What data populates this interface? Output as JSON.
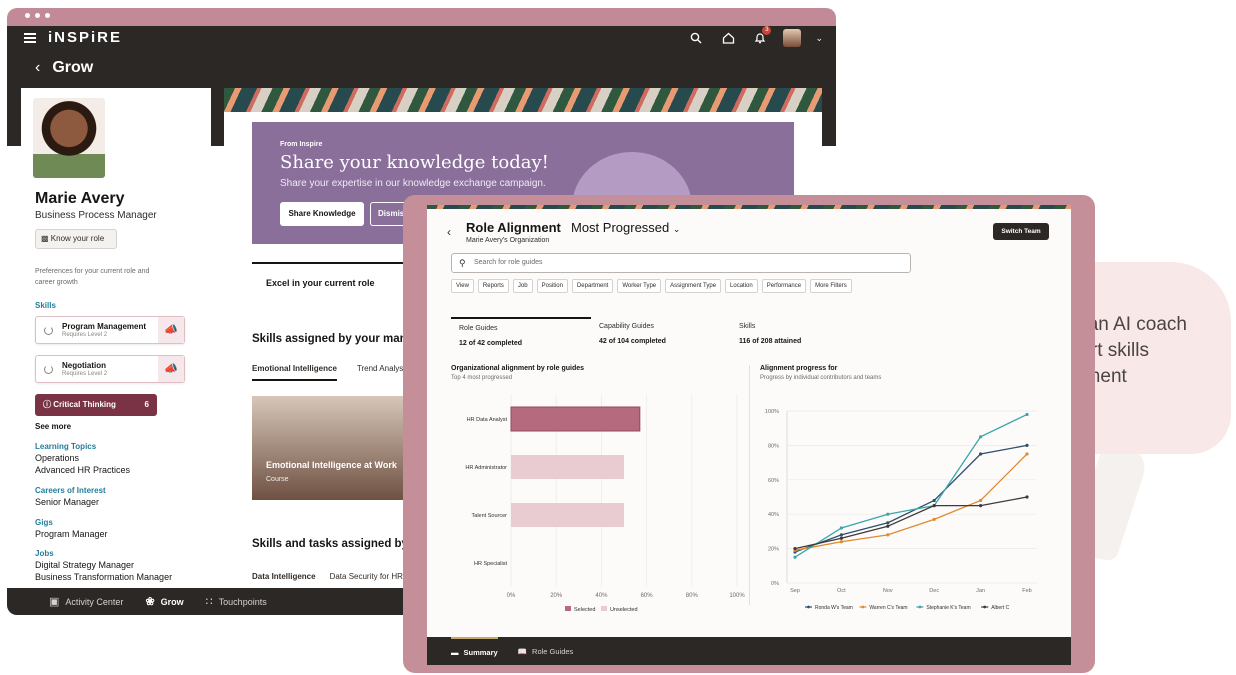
{
  "back_app": {
    "brand": "iNSPiRE",
    "notification_count": "3",
    "page_title": "Grow",
    "profile": {
      "name": "Marie Avery",
      "role": "Business Process Manager",
      "know_role_button": "Know your role",
      "preferences_text": "Preferences for your current role and career growth"
    },
    "skills": {
      "heading": "Skills",
      "items": [
        {
          "name": "Program Management",
          "level": "Requires Level 2"
        },
        {
          "name": "Negotiation",
          "level": "Requires Level 2"
        }
      ],
      "critical": {
        "label": "Critical Thinking",
        "count": "6"
      },
      "see_more": "See more"
    },
    "sections": [
      {
        "heading": "Learning Topics",
        "items": [
          "Operations",
          "Advanced HR Practices"
        ]
      },
      {
        "heading": "Careers of Interest",
        "items": [
          "Senior Manager"
        ]
      },
      {
        "heading": "Gigs",
        "items": [
          "Program Manager"
        ]
      },
      {
        "heading": "Jobs",
        "items": [
          "Digital Strategy Manager",
          "Business Transformation Manager"
        ]
      }
    ],
    "banner": {
      "from": "From Inspire",
      "heading": "Share your knowledge today!",
      "subtext": "Share your expertise in our knowledge exchange campaign.",
      "primary_button": "Share Knowledge",
      "secondary_button": "Dismiss"
    },
    "excel_tab": "Excel in your current role",
    "skills_assigned_heading": "Skills assigned by your manager",
    "skill_tabs": [
      "Emotional Intelligence",
      "Trend Analysis"
    ],
    "course_card": {
      "title": "Emotional Intelligence at Work",
      "type": "Course"
    },
    "tasks_heading": "Skills and tasks assigned by your manager",
    "task_tabs": [
      "Data Intelligence",
      "Data Security for HR"
    ],
    "bottom_nav": [
      "Activity Center",
      "Grow",
      "Touchpoints"
    ]
  },
  "front_app": {
    "title": "Role Alignment",
    "mode": "Most Progressed",
    "org": "Marie Avery's Organization",
    "switch_team": "Switch Team",
    "search_placeholder": "Search for role guides",
    "filters": [
      "View",
      "Reports",
      "Job",
      "Position",
      "Department",
      "Worker Type",
      "Assignment Type",
      "Location",
      "Performance",
      "More Filters"
    ],
    "metrics": [
      {
        "label": "Role Guides",
        "value": "12 of 42 completed"
      },
      {
        "label": "Capability Guides",
        "value": "42 of 104 completed"
      },
      {
        "label": "Skills",
        "value": "116 of 208 attained"
      }
    ],
    "bar_chart_title": "Organizational alignment by role guides",
    "bar_chart_subtitle": "Top 4 most progressed",
    "line_chart_title": "Alignment progress for",
    "line_chart_subtitle": "Progress by individual contributors and teams",
    "bottom_nav": [
      "Summary",
      "Role Guides"
    ]
  },
  "colors": {
    "dark_bar": "#2b2826",
    "frame": "#c58f99",
    "bar_selected": "#b56a7e",
    "bar_unselected": "#e8ccd2",
    "series": [
      "#2f4f6f",
      "#e08a2e",
      "#3aa6a8",
      "#3f3a36"
    ]
  },
  "chart_data": [
    {
      "type": "bar",
      "orientation": "horizontal",
      "categories": [
        "HR Data Analyst",
        "HR Administrator",
        "Talent Sourcer",
        "HR Specialist"
      ],
      "values": [
        57,
        50,
        50,
        0
      ],
      "selected": [
        true,
        false,
        false,
        false
      ],
      "xlim": [
        0,
        100
      ],
      "x_ticks": [
        "0%",
        "20%",
        "40%",
        "60%",
        "80%",
        "100%"
      ],
      "legend": [
        "Selected",
        "Unselected"
      ]
    },
    {
      "type": "line",
      "categories": [
        "Sep",
        "Oct",
        "Nov",
        "Dec",
        "Jan",
        "Feb"
      ],
      "ylim": [
        0,
        100
      ],
      "y_ticks": [
        "0%",
        "20%",
        "40%",
        "60%",
        "80%",
        "100%"
      ],
      "series": [
        {
          "name": "Ronda W's Team",
          "values": [
            18,
            28,
            35,
            48,
            75,
            80
          ]
        },
        {
          "name": "Warren C's Team",
          "values": [
            19,
            24,
            28,
            37,
            48,
            75
          ]
        },
        {
          "name": "Stephanie K's Team",
          "values": [
            15,
            32,
            40,
            45,
            85,
            98
          ]
        },
        {
          "name": "Albert C",
          "values": [
            20,
            26,
            33,
            45,
            45,
            50
          ]
        }
      ]
    }
  ],
  "callout": "Provide an AI coach to support skills development"
}
